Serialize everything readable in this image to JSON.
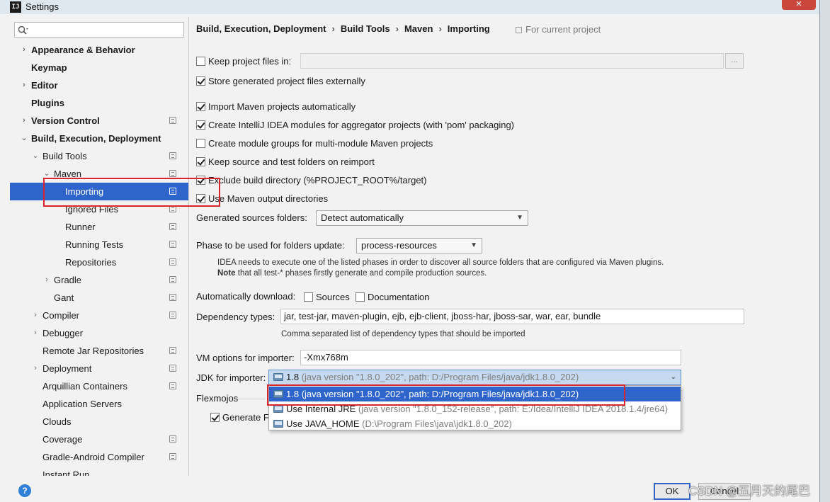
{
  "window": {
    "title": "Settings",
    "app_icon": "IJ"
  },
  "search": {
    "value": "",
    "placeholder": ""
  },
  "sidebar": {
    "items": [
      {
        "label": "Appearance & Behavior",
        "arrow": "›",
        "bold": true
      },
      {
        "label": "Keymap",
        "arrow": "",
        "bold": true
      },
      {
        "label": "Editor",
        "arrow": "›",
        "bold": true
      },
      {
        "label": "Plugins",
        "arrow": "",
        "bold": true
      },
      {
        "label": "Version Control",
        "arrow": "›",
        "bold": true
      },
      {
        "label": "Build, Execution, Deployment",
        "arrow": "⌄",
        "bold": true
      },
      {
        "label": "Build Tools",
        "arrow": "⌄"
      },
      {
        "label": "Maven",
        "arrow": "⌄"
      },
      {
        "label": "Importing",
        "arrow": ""
      },
      {
        "label": "Ignored Files",
        "arrow": ""
      },
      {
        "label": "Runner",
        "arrow": ""
      },
      {
        "label": "Running Tests",
        "arrow": ""
      },
      {
        "label": "Repositories",
        "arrow": ""
      },
      {
        "label": "Gradle",
        "arrow": "›"
      },
      {
        "label": "Gant",
        "arrow": ""
      },
      {
        "label": "Compiler",
        "arrow": "›"
      },
      {
        "label": "Debugger",
        "arrow": "›"
      },
      {
        "label": "Remote Jar Repositories",
        "arrow": ""
      },
      {
        "label": "Deployment",
        "arrow": "›"
      },
      {
        "label": "Arquillian Containers",
        "arrow": ""
      },
      {
        "label": "Application Servers",
        "arrow": ""
      },
      {
        "label": "Clouds",
        "arrow": ""
      },
      {
        "label": "Coverage",
        "arrow": ""
      },
      {
        "label": "Gradle-Android Compiler",
        "arrow": ""
      },
      {
        "label": "Instant Run",
        "arrow": ""
      }
    ]
  },
  "breadcrumb": {
    "items": [
      "Build, Execution, Deployment",
      "Build Tools",
      "Maven",
      "Importing"
    ],
    "separator": "›",
    "scope_note": "For current project"
  },
  "options": {
    "keep_project_files": "Keep project files in:",
    "keep_project_files_path": "",
    "browse": "...",
    "store_externally": "Store generated project files externally",
    "import_automatically": "Import Maven projects automatically",
    "create_modules": "Create IntelliJ IDEA modules for aggregator projects (with 'pom' packaging)",
    "create_groups": "Create module groups for multi-module Maven projects",
    "keep_source": "Keep source and test folders on reimport",
    "exclude_build": "Exclude build directory (%PROJECT_ROOT%/target)",
    "use_output": "Use Maven output directories"
  },
  "generated_sources": {
    "label": "Generated sources folders:",
    "value": "Detect automatically"
  },
  "phase": {
    "label": "Phase to be used for folders update:",
    "value": "process-resources",
    "hint1": "IDEA needs to execute one of the listed phases in order to discover all source folders that are configured via Maven plugins.",
    "hint2_bold": "Note",
    "hint2": " that all test-* phases firstly generate and compile production sources."
  },
  "auto_download": {
    "label": "Automatically download:",
    "sources": "Sources",
    "documentation": "Documentation"
  },
  "dependency_types": {
    "label": "Dependency types:",
    "value": "jar, test-jar, maven-plugin, ejb, ejb-client, jboss-har, jboss-sar, war, ear, bundle",
    "hint": "Comma separated list of dependency types that should be imported"
  },
  "vm_options": {
    "label": "VM options for importer:",
    "value": "-Xmx768m"
  },
  "jdk_importer": {
    "label": "JDK for importer:",
    "selected_name": "1.8",
    "selected_detail": " (java version \"1.8.0_202\", path: D:/Program Files/java/jdk1.8.0_202)",
    "options": [
      {
        "name": "1.8",
        "detail": " (java version \"1.8.0_202\", path: D:/Program Files/java/jdk1.8.0_202)"
      },
      {
        "name": "Use Internal JRE",
        "detail": " (java version \"1.8.0_152-release\", path: E:/Idea/IntelliJ IDEA 2018.1.4/jre64)"
      },
      {
        "name": "Use JAVA_HOME",
        "detail": " (D:\\Program Files\\java\\jdk1.8.0_202)"
      }
    ]
  },
  "flexmojos": {
    "label": "Flexmojos",
    "generate": "Generate Fl"
  },
  "footer": {
    "ok": "OK",
    "cancel": "Cancel",
    "help": "?",
    "watermark": "CSDN @五月天的尾巴"
  },
  "colors": {
    "selection": "#2f65ca",
    "highlight_box": "#d9262c"
  }
}
